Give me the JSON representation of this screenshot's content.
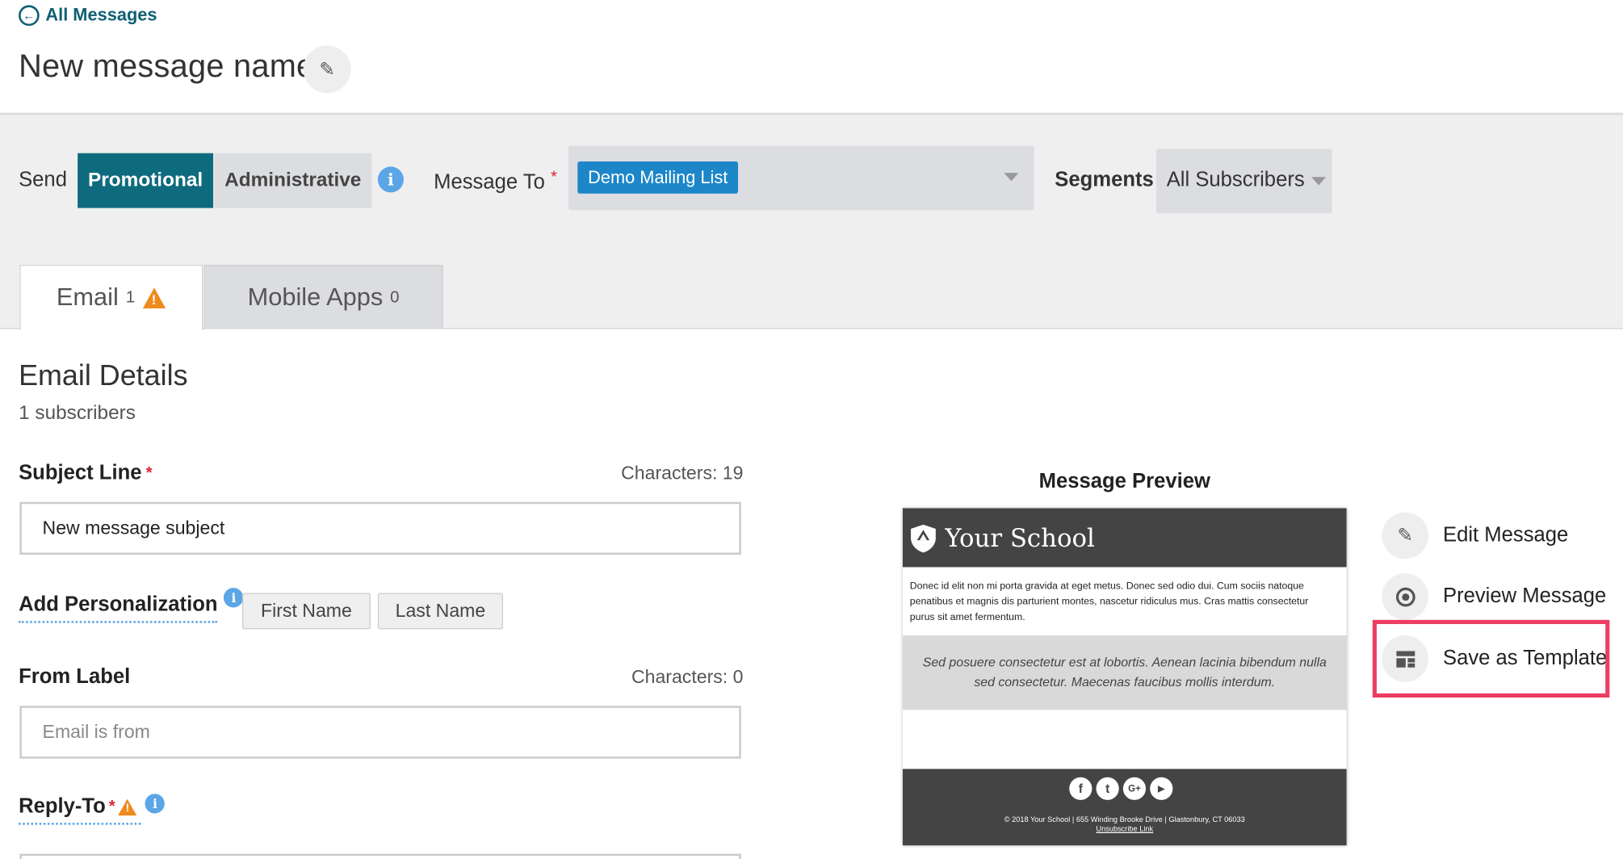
{
  "header": {
    "back_label": "All Messages",
    "title": "New message name"
  },
  "send": {
    "label": "Send",
    "options": [
      "Promotional",
      "Administrative"
    ],
    "selected": "Promotional"
  },
  "message_to": {
    "label": "Message To",
    "required_mark": "*",
    "selected_list": "Demo Mailing List"
  },
  "segments": {
    "label": "Segments",
    "value": "All Subscribers"
  },
  "tabs": [
    {
      "label": "Email",
      "count": "1",
      "warning": true
    },
    {
      "label": "Mobile Apps",
      "count": "0",
      "warning": false
    }
  ],
  "email_details": {
    "title": "Email Details",
    "subscribers": "1 subscribers",
    "subject": {
      "label": "Subject Line",
      "required_mark": "*",
      "char_count": "Characters: 19",
      "value": "New message subject"
    },
    "personalization": {
      "label": "Add Personalization",
      "buttons": [
        "First Name",
        "Last Name"
      ]
    },
    "from_label": {
      "label": "From Label",
      "char_count": "Characters: 0",
      "placeholder": "Email is from"
    },
    "reply_to": {
      "label": "Reply-To",
      "required_mark": "*"
    }
  },
  "preview": {
    "title": "Message Preview",
    "school_name": "Your School",
    "body_text": "Donec id elit non mi porta gravida at eget metus. Donec sed odio dui. Cum sociis natoque penatibus et magnis dis parturient montes, nascetur ridiculus mus. Cras mattis consectetur purus sit amet fermentum.",
    "quote_text": "Sed posuere consectetur est at lobortis. Aenean lacinia bibendum nulla sed consectetur. Maecenas faucibus mollis interdum.",
    "social_icons": [
      "f",
      "t",
      "G+",
      "▶"
    ],
    "footer_address": "© 2018   Your School  |  655 Winding Brooke Drive  |  Glastonbury, CT 06033",
    "unsubscribe": "Unsubscribe Link"
  },
  "actions": [
    {
      "label": "Edit Message",
      "icon": "pencil-icon"
    },
    {
      "label": "Preview Message",
      "icon": "eye-icon"
    },
    {
      "label": "Save as Template",
      "icon": "template-icon"
    }
  ],
  "colors": {
    "accent": "#0e6b7d",
    "chip": "#1d86c8",
    "highlight": "#ec3d62",
    "warning": "#f08a1c"
  }
}
